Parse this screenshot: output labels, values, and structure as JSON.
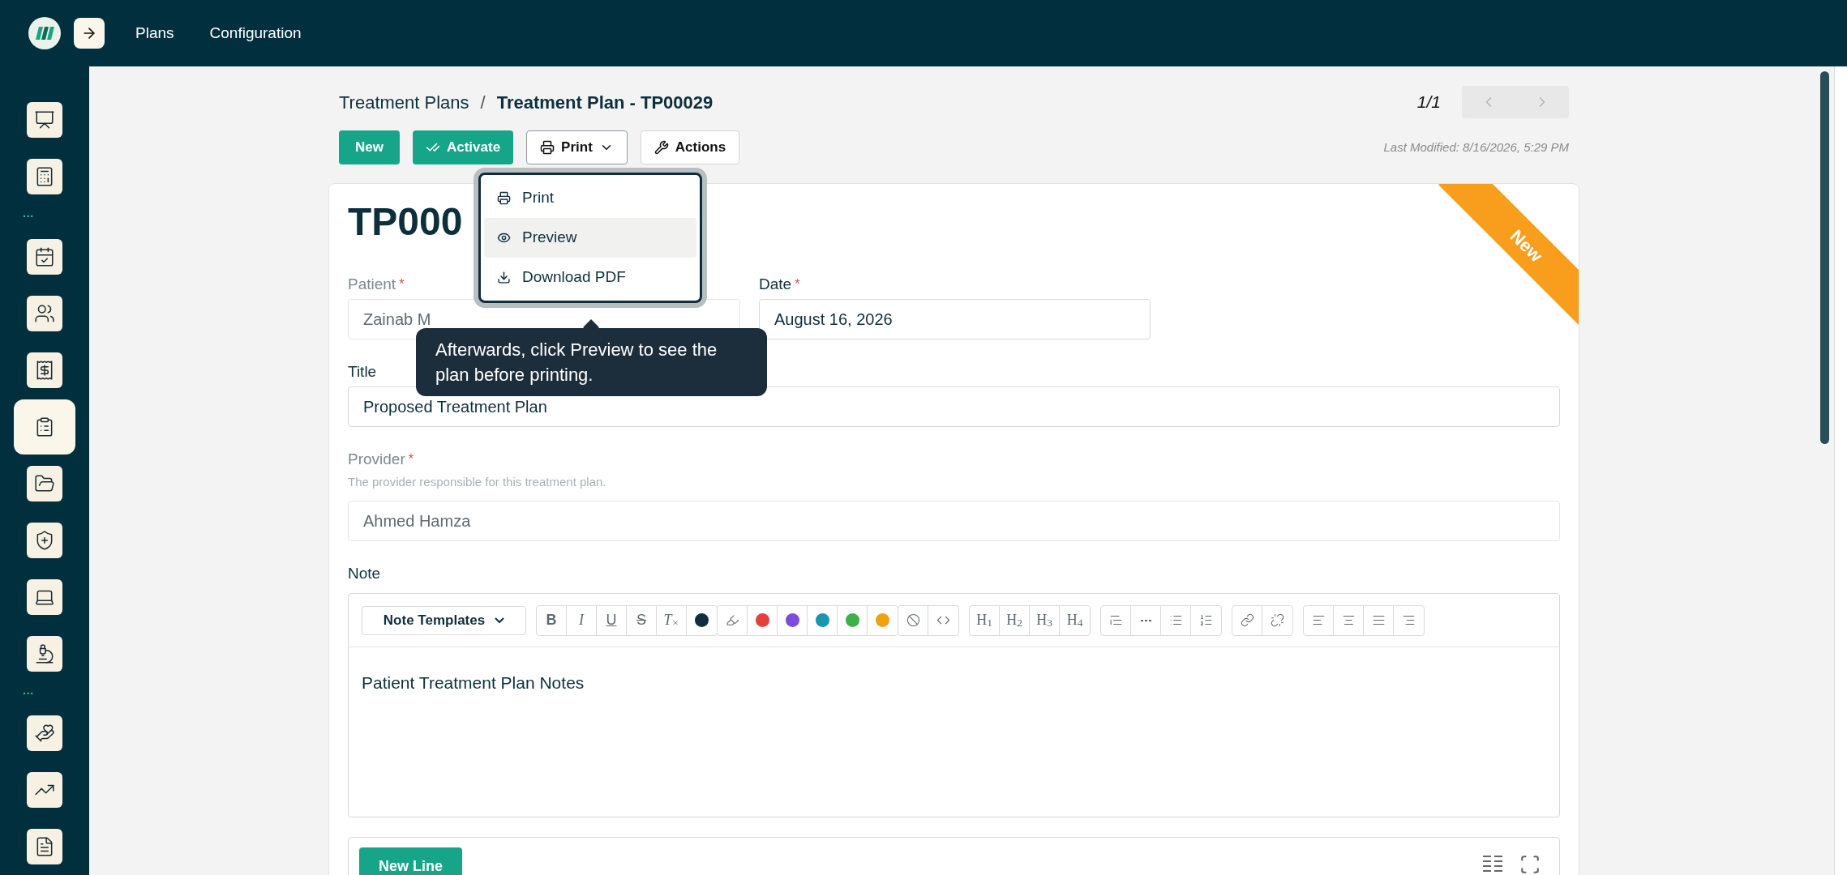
{
  "header": {
    "nav": [
      {
        "label": "Plans"
      },
      {
        "label": "Configuration"
      }
    ]
  },
  "sidebar": {
    "items": [
      {
        "kind": "icon",
        "selected": false
      },
      {
        "kind": "icon",
        "selected": false
      },
      {
        "kind": "separator",
        "label": "···"
      },
      {
        "kind": "icon",
        "selected": false
      },
      {
        "kind": "icon",
        "selected": false
      },
      {
        "kind": "icon",
        "selected": false
      },
      {
        "kind": "icon",
        "selected": true
      },
      {
        "kind": "icon",
        "selected": false
      },
      {
        "kind": "icon",
        "selected": false
      },
      {
        "kind": "icon",
        "selected": false
      },
      {
        "kind": "icon",
        "selected": false
      },
      {
        "kind": "separator",
        "label": "···"
      },
      {
        "kind": "icon",
        "selected": false
      },
      {
        "kind": "icon",
        "selected": false
      },
      {
        "kind": "icon",
        "selected": false
      }
    ]
  },
  "breadcrumb": {
    "parent": "Treatment Plans",
    "separator": "/",
    "current": "Treatment Plan - TP00029"
  },
  "pager": {
    "position": "1/1",
    "prev_disabled": true,
    "next_disabled": true
  },
  "actions": [
    {
      "label": "New",
      "kind": "primary"
    },
    {
      "label": "Activate",
      "kind": "activate"
    },
    {
      "label": "Print",
      "kind": "menu",
      "expanded": true
    },
    {
      "label": "Actions",
      "kind": "tools"
    }
  ],
  "last_modified": "Last Modified: 8/16/2026, 5:29 PM",
  "print_menu": {
    "items": [
      {
        "label": "Print",
        "selected": false
      },
      {
        "label": "Preview",
        "selected": true
      },
      {
        "label": "Download PDF",
        "selected": false
      }
    ]
  },
  "tooltip": "Afterwards, click Preview to see the plan before printing.",
  "record": {
    "title": "TP000",
    "ribbon": "New"
  },
  "fields": [
    {
      "label": "Patient",
      "mark": "*",
      "value": "Zainab M",
      "disabled": true
    },
    {
      "label": "Date",
      "mark": "*",
      "value": "August 16, 2026",
      "disabled": false
    },
    {
      "label": "Title",
      "value": "Proposed Treatment Plan",
      "disabled": false
    },
    {
      "label": "Provider",
      "mark": "*",
      "hint": "The provider responsible for this treatment plan.",
      "value": "Ahmed Hamza",
      "disabled": true
    }
  ],
  "note": {
    "label": "Note",
    "templates": "Note Templates",
    "content": "Patient Treatment Plan Notes",
    "toolbar": [
      {
        "items": [
          {
            "kind": "bold",
            "label": "B"
          },
          {
            "kind": "italic",
            "label": "I"
          },
          {
            "kind": "underline",
            "label": "U"
          },
          {
            "kind": "strike",
            "label": "S"
          },
          {
            "kind": "clear",
            "label": "T$_{×}$"
          },
          {
            "kind": "color",
            "color": "#0f2e3d"
          }
        ]
      },
      {
        "items": [
          {
            "kind": "highlight"
          },
          {
            "kind": "color",
            "color": "#e53e3e"
          },
          {
            "kind": "color",
            "color": "#7c4ddb"
          },
          {
            "kind": "color",
            "color": "#1a96ad"
          },
          {
            "kind": "color",
            "color": "#3cb14a"
          },
          {
            "kind": "color",
            "color": "#f0a011"
          }
        ]
      },
      {
        "items": [
          {
            "kind": "noformat"
          },
          {
            "kind": "code"
          }
        ]
      },
      {
        "items": [
          {
            "kind": "heading",
            "label": "H$_{1}$"
          },
          {
            "kind": "heading",
            "label": "H$_{2}$"
          },
          {
            "kind": "heading",
            "label": "H$_{3}$"
          },
          {
            "kind": "heading",
            "label": "H$_{4}$"
          }
        ]
      },
      {
        "items": [
          {
            "kind": "quote"
          },
          {
            "kind": "rule"
          },
          {
            "kind": "bullets"
          },
          {
            "kind": "numbers"
          }
        ]
      },
      {
        "items": [
          {
            "kind": "link"
          },
          {
            "kind": "unlink"
          }
        ]
      },
      {
        "items": [
          {
            "kind": "align-left"
          },
          {
            "kind": "align-center"
          },
          {
            "kind": "align-justify"
          },
          {
            "kind": "align-right"
          }
        ]
      }
    ]
  },
  "lines": {
    "button": "New Line"
  }
}
